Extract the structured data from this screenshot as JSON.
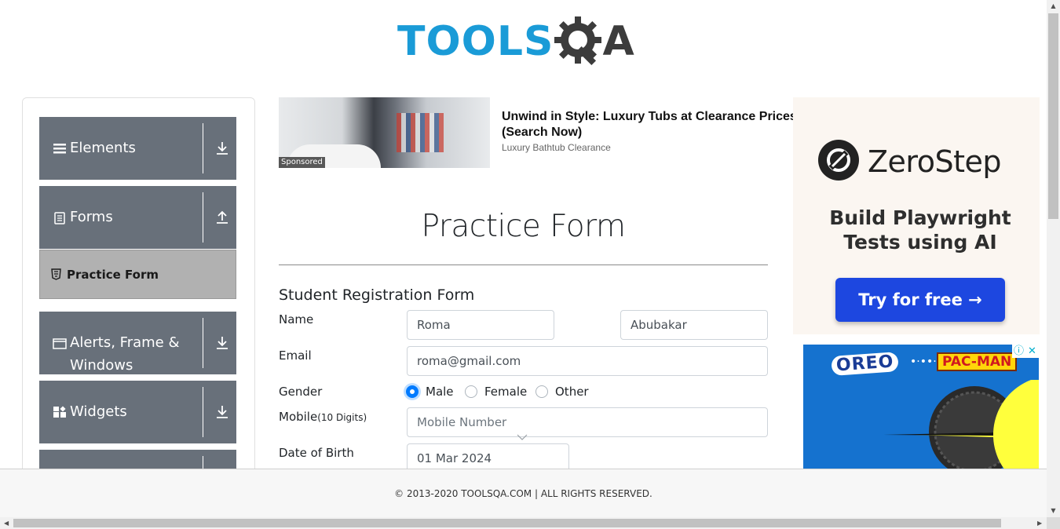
{
  "header": {
    "logo_part1": "TOOLS",
    "logo_part2": "A",
    "logo_icon": "gear-q-icon"
  },
  "sidebar": {
    "groups": [
      {
        "label": "Elements",
        "icon": "menu-icon",
        "arrow": "download-icon"
      },
      {
        "label": "Forms",
        "icon": "document-icon",
        "arrow": "upload-icon"
      },
      {
        "label": "Alerts, Frame & Windows",
        "icon": "window-icon",
        "arrow": "download-icon"
      },
      {
        "label": "Widgets",
        "icon": "widgets-icon",
        "arrow": "download-icon"
      }
    ],
    "sub_item": {
      "label": "Practice Form",
      "icon": "html-icon"
    }
  },
  "top_ad": {
    "badge": "Sponsored",
    "title": "Unwind in Style: Luxury Tubs at Clearance Prices (Search Now)",
    "subtitle": "Luxury Bathtub Clearance"
  },
  "form": {
    "title": "Practice Form",
    "heading": "Student Registration Form",
    "name_label": "Name",
    "first_name": "Roma",
    "last_name": "Abubakar",
    "email_label": "Email",
    "email": "roma@gmail.com",
    "gender_label": "Gender",
    "gender_options": [
      "Male",
      "Female",
      "Other"
    ],
    "gender_selected": "Male",
    "mobile_label": "Mobile",
    "mobile_hint": "(10 Digits)",
    "mobile_placeholder": "Mobile Number",
    "dob_label": "Date of Birth",
    "dob_value": "01 Mar 2024"
  },
  "right_ad": {
    "brand": "ZeroStep",
    "tagline": "Build Playwright Tests using AI",
    "button": "Try for free →",
    "colors": {
      "button": "#1d47e0",
      "background": "#fbf6f1"
    }
  },
  "oreo_ad": {
    "brand": "OREO",
    "partner": "PAC-MAN",
    "dots": "•·••·•"
  },
  "footer": {
    "text": "© 2013-2020 TOOLSQA.COM | ALL RIGHTS RESERVED."
  },
  "colors": {
    "brand_blue": "#1a9bd7",
    "sidebar_group": "#68707a",
    "radio_checked": "#007bff"
  }
}
